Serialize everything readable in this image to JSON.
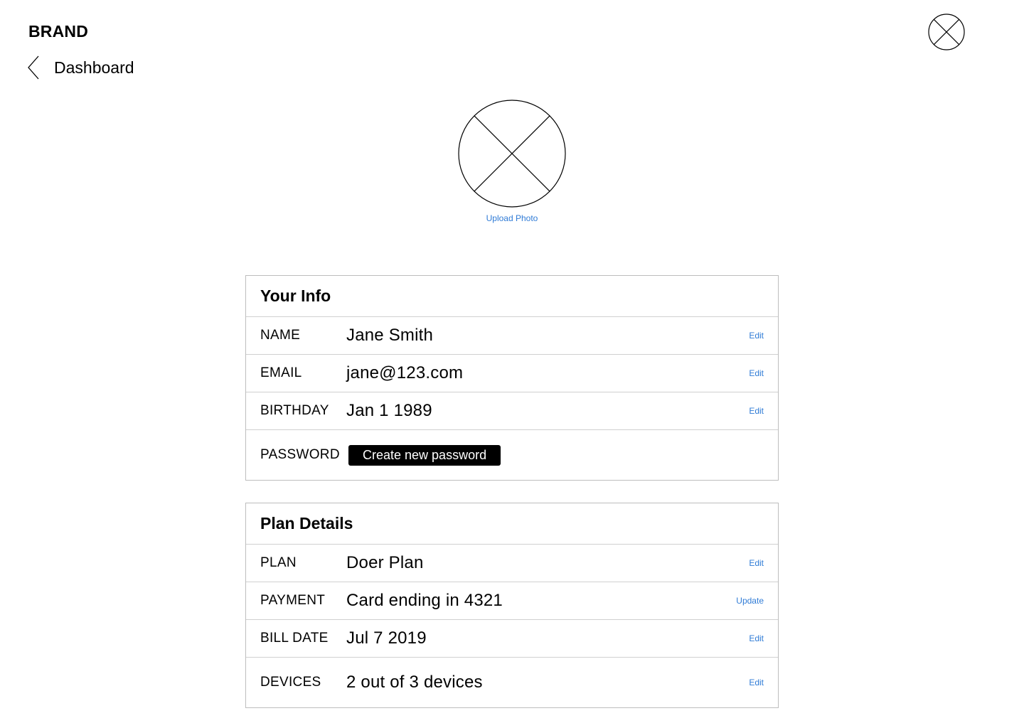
{
  "header": {
    "brand": "BRAND",
    "back_label": "Dashboard",
    "back_icon": "chevron-left-icon",
    "avatar_icon": "image-placeholder-icon"
  },
  "photo": {
    "placeholder_icon": "image-placeholder-icon",
    "upload_label": "Upload Photo"
  },
  "colors": {
    "link": "#2f7bd6",
    "button_bg": "#000000",
    "border": "#bdbdbd"
  },
  "info": {
    "title": "Your Info",
    "rows": [
      {
        "label": "NAME",
        "value": "Jane Smith",
        "action": "Edit"
      },
      {
        "label": "EMAIL",
        "value": "jane@123.com",
        "action": "Edit"
      },
      {
        "label": "BIRTHDAY",
        "value": "Jan 1 1989",
        "action": "Edit"
      }
    ],
    "password": {
      "label": "PASSWORD",
      "button_label": "Create new password"
    }
  },
  "plan": {
    "title": "Plan Details",
    "rows": [
      {
        "label": "PLAN",
        "value": "Doer Plan",
        "action": "Edit"
      },
      {
        "label": "PAYMENT",
        "value": "Card ending in 4321",
        "action": "Update"
      },
      {
        "label": "BILL DATE",
        "value": "Jul 7 2019",
        "action": "Edit"
      },
      {
        "label": "DEVICES",
        "value": "2 out of 3 devices",
        "action": "Edit"
      }
    ]
  }
}
